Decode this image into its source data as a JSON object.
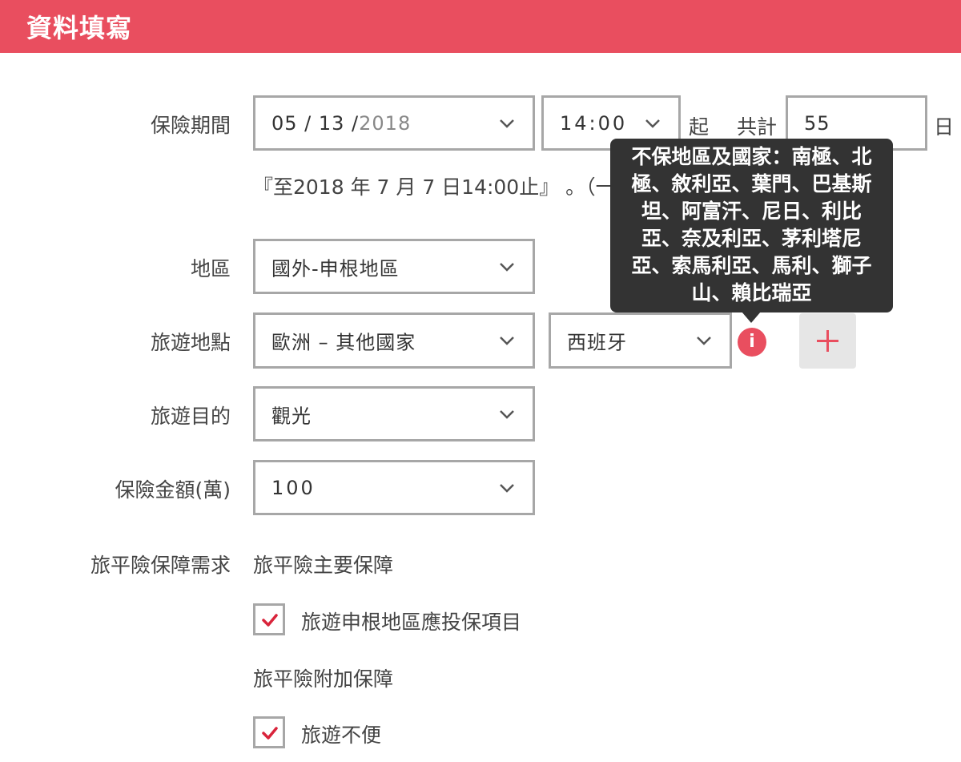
{
  "header": {
    "title": "資料填寫"
  },
  "period": {
    "label": "保險期間",
    "date_month_day": "05 / 13 /",
    "date_year": "2018",
    "time": "14:00",
    "start_suffix": "起",
    "total_label": "共計",
    "days": "55",
    "days_unit": "日",
    "end_note": "『至2018 年 7 月 7 日14:00止』 。（一"
  },
  "region": {
    "label": "地區",
    "value": "國外-申根地區"
  },
  "destination": {
    "label": "旅遊地點",
    "area": "歐洲 – 其他國家",
    "country": "西班牙",
    "info_icon": "i",
    "tooltip": "不保地區及國家：南極、北極、敘利亞、葉門、巴基斯坦、阿富汗、尼日、利比亞、奈及利亞、茅利塔尼亞、索馬利亞、馬利、獅子山、賴比瑞亞"
  },
  "purpose": {
    "label": "旅遊目的",
    "value": "觀光"
  },
  "amount": {
    "label": "保險金額(萬)",
    "value": "100"
  },
  "coverage": {
    "label": "旅平險保障需求",
    "main_title": "旅平險主要保障",
    "main_item": "旅遊申根地區應投保項目",
    "addon_title": "旅平險附加保障",
    "addon_item": "旅遊不便"
  },
  "colors": {
    "brand": "#e94e5f",
    "tooltip_bg": "#333333",
    "border": "#a7a7a7",
    "check": "#d9243b"
  },
  "icons": {
    "dropdown": "chevron-down-icon",
    "info": "info-icon",
    "add": "plus-icon",
    "check": "checkmark-icon"
  }
}
